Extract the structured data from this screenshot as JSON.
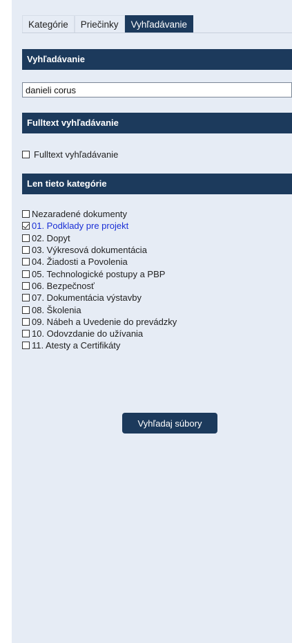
{
  "tabs": [
    {
      "label": "Kategórie",
      "active": false
    },
    {
      "label": "Priečinky",
      "active": false
    },
    {
      "label": "Vyhľadávanie",
      "active": true
    }
  ],
  "search_section": {
    "header": "Vyhľadávanie",
    "value": "danieli corus"
  },
  "fulltext_section": {
    "header": "Fulltext vyhľadávanie",
    "checkbox_label": "Fulltext vyhľadávanie",
    "checked": false
  },
  "categories_section": {
    "header": "Len tieto kategórie",
    "items": [
      {
        "label": "Nezaradené dokumenty",
        "checked": false
      },
      {
        "label": "01. Podklady pre projekt",
        "checked": true
      },
      {
        "label": "02. Dopyt",
        "checked": false
      },
      {
        "label": "03. Výkresová dokumentácia",
        "checked": false
      },
      {
        "label": "04. Žiadosti a Povolenia",
        "checked": false
      },
      {
        "label": "05. Technologické postupy a PBP",
        "checked": false
      },
      {
        "label": "06. Bezpečnosť",
        "checked": false
      },
      {
        "label": "07. Dokumentácia výstavby",
        "checked": false
      },
      {
        "label": "08. Školenia",
        "checked": false
      },
      {
        "label": "09. Nábeh a Uvedenie do prevádzky",
        "checked": false
      },
      {
        "label": "10. Odovzdanie do užívania",
        "checked": false
      },
      {
        "label": "11. Atesty a Certifikáty",
        "checked": false
      }
    ]
  },
  "search_button": {
    "label": "Vyhľadaj súbory"
  },
  "colors": {
    "header_bg": "#1c3a5c",
    "panel_bg": "#e6ecf5",
    "selected_text": "#1a2fd6"
  }
}
